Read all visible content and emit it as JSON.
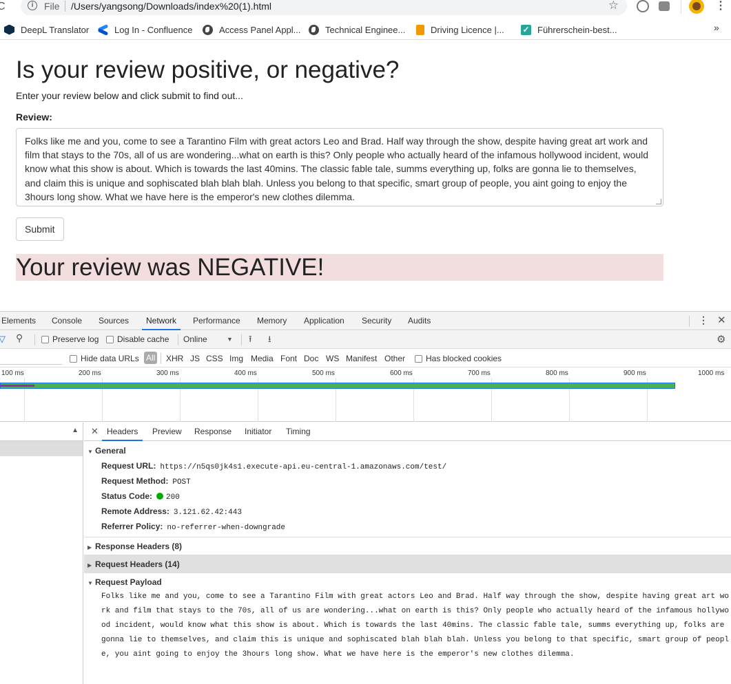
{
  "browser": {
    "scheme": "File",
    "url": "/Users/yangsong/Downloads/index%20(1).html",
    "bookmarks": [
      {
        "label": "DeepL Translator",
        "icon": "deepl-icon"
      },
      {
        "label": "Log In - Confluence",
        "icon": "confluence-icon"
      },
      {
        "label": "Access Panel Appl...",
        "icon": "globe-icon"
      },
      {
        "label": "Technical Enginee...",
        "icon": "globe-icon"
      },
      {
        "label": "Driving Licence |...",
        "icon": "book-icon"
      },
      {
        "label": "Führerschein-best...",
        "icon": "check-icon"
      }
    ],
    "more": "»"
  },
  "page": {
    "title": "Is your review positive, or negative?",
    "intro": "Enter your review below and click submit to find out...",
    "review_label": "Review:",
    "review_text": "Folks like me and you, come to see a Tarantino Film with great actors Leo and Brad. Half way through the show, despite having great art work and film that stays to the 70s, all of us are wondering...what on earth is this? Only people who actually heard of the infamous hollywood incident, would know what this show is about. Which is towards the last 40mins. The classic fable tale, summs everything up, folks are gonna lie to themselves, and claim this is unique and sophiscated blah blah blah. Unless you belong to that specific, smart group of people, you aint going to enjoy the 3hours long show. What we have here is the emperor's new clothes dilemma.",
    "submit_label": "Submit",
    "result": "Your review was NEGATIVE!",
    "result_bg": "#f2dede"
  },
  "devtools": {
    "tabs": [
      "Elements",
      "Console",
      "Sources",
      "Network",
      "Performance",
      "Memory",
      "Application",
      "Security",
      "Audits"
    ],
    "active_tab": "Network",
    "toolbar": {
      "preserve_log": "Preserve log",
      "disable_cache": "Disable cache",
      "throttle": "Online"
    },
    "filters": {
      "hide_data_urls": "Hide data URLs",
      "types": [
        "All",
        "XHR",
        "JS",
        "CSS",
        "Img",
        "Media",
        "Font",
        "Doc",
        "WS",
        "Manifest",
        "Other"
      ],
      "has_blocked_cookies": "Has blocked cookies"
    },
    "timeline_ticks": [
      "100 ms",
      "200 ms",
      "300 ms",
      "400 ms",
      "500 ms",
      "600 ms",
      "700 ms",
      "800 ms",
      "900 ms",
      "1000 ms"
    ],
    "detail_tabs": [
      "Headers",
      "Preview",
      "Response",
      "Initiator",
      "Timing"
    ],
    "active_detail_tab": "Headers",
    "general": {
      "title": "General",
      "request_url_k": "Request URL:",
      "request_url": "https://n5qs0jk4s1.execute-api.eu-central-1.amazonaws.com/test/",
      "method_k": "Request Method:",
      "method": "POST",
      "status_k": "Status Code:",
      "status": "200",
      "remote_k": "Remote Address:",
      "remote": "3.121.62.42:443",
      "referrer_k": "Referrer Policy:",
      "referrer": "no-referrer-when-downgrade"
    },
    "response_headers": "Response Headers (8)",
    "request_headers": "Request Headers (14)",
    "payload_title": "Request Payload",
    "payload_lines": [
      "Folks like me and you, come to see a Tarantino Film with great actors Leo and Brad. Half way through the show, despite having great art wo",
      "rk and film that stays to the 70s, all of us are wondering...what on earth is this? Only people who actually heard of the infamous hollywo",
      "od incident, would know what this show is about. Which is towards the last 40mins. The classic fable tale, summs everything up, folks are",
      "gonna lie to themselves, and claim this is unique and sophiscated blah blah blah. Unless you belong to that specific, smart group of peopl",
      "e, you aint going to enjoy the 3hours long show. What we have here is the emperor's new clothes dilemma."
    ]
  }
}
